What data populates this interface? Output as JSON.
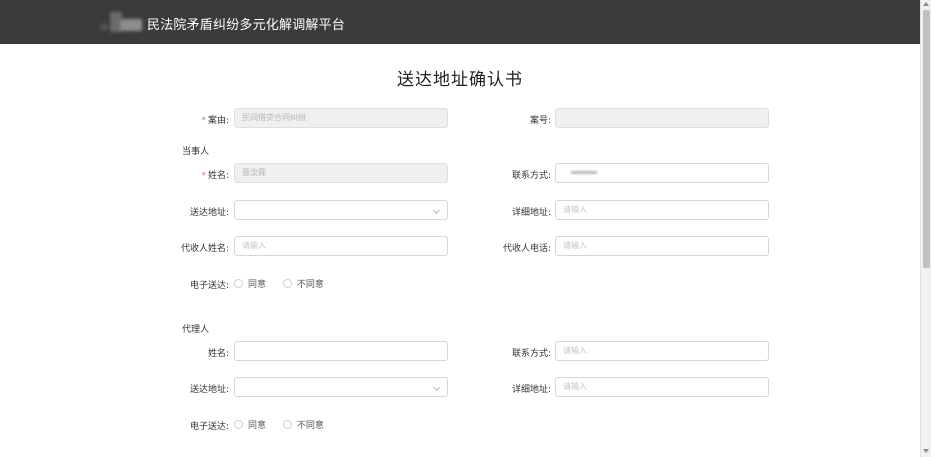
{
  "header": {
    "platform_title": "民法院矛盾纠纷多元化解调解平台"
  },
  "form": {
    "title": "送达地址确认书",
    "case_reason": {
      "label": "案由:",
      "value": "民间借贷合同纠纷"
    },
    "case_number": {
      "label": "案号:",
      "value": ""
    },
    "party": {
      "section_label": "当事人",
      "name": {
        "label": "姓名:",
        "value": "意汝霖"
      },
      "contact": {
        "label": "联系方式:",
        "value": ""
      },
      "delivery_address": {
        "label": "送达地址:",
        "value": ""
      },
      "detail_address": {
        "label": "详细地址:",
        "placeholder": "请输入"
      },
      "recipient_name": {
        "label": "代收人姓名:",
        "placeholder": "请输入"
      },
      "recipient_phone": {
        "label": "代收人电话:",
        "placeholder": "请输入"
      },
      "e_delivery": {
        "label": "电子送达:",
        "options": [
          "同意",
          "不同意"
        ]
      }
    },
    "agent": {
      "section_label": "代理人",
      "name": {
        "label": "姓名:",
        "value": ""
      },
      "contact": {
        "label": "联系方式:",
        "placeholder": "请输入"
      },
      "delivery_address": {
        "label": "送达地址:",
        "value": ""
      },
      "detail_address": {
        "label": "详细地址:",
        "placeholder": "请输入"
      },
      "e_delivery": {
        "label": "电子送达:",
        "options": [
          "同意",
          "不同意"
        ]
      }
    }
  },
  "colors": {
    "header_bg": "#3b3b3b",
    "required_mark": "#f56c6c",
    "disabled_bg": "#f0f0f0"
  }
}
